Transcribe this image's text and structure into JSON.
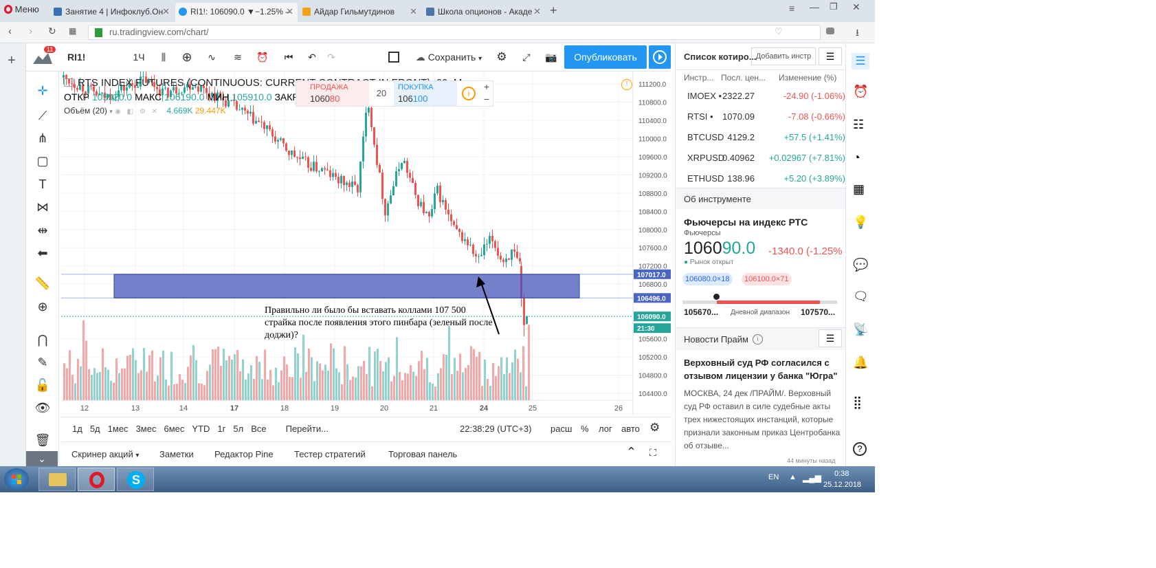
{
  "browser": {
    "menu_label": "Меню",
    "tabs": [
      {
        "title": "Занятие 4 | Инфоклуб.Он",
        "active": false
      },
      {
        "title": "RI1!: 106090.0 ▼−1.25% –",
        "active": true
      },
      {
        "title": "Айдар Гильмутдинов",
        "active": false
      },
      {
        "title": "Школа опционов - Акаде",
        "active": false
      }
    ],
    "url": "ru.tradingview.com/chart/"
  },
  "toolbar": {
    "symbol": "RI1!",
    "interval": "1Ч",
    "save_label": "Сохранить",
    "publish_label": "Опубликовать",
    "notification_count": "11"
  },
  "legend": {
    "title": "RTS INDEX FUTURES (CONTINUOUS: CURRENT CONTRACT IN FRONT), 60, MOEX",
    "open_label": "ОТКР",
    "open": "105920.0",
    "high_label": "МАКС",
    "high": "106190.0",
    "low_label": "МИН",
    "low": "105910.0",
    "close_label": "ЗАКР",
    "close": "1",
    "volume_label": "Объём (20)",
    "volume_value": "4.669K",
    "volume_ma": "29.447K"
  },
  "trade_widget": {
    "sell_label": "ПРОДАЖА",
    "sell_price_main": "1060",
    "sell_price_tail": "80",
    "spread": "20",
    "buy_label": "ПОКУПКА",
    "buy_price_main": "106",
    "buy_price_tail": "100"
  },
  "chart_data": {
    "type": "candlestick",
    "price_axis_ticks": [
      "111200.0",
      "110800.0",
      "110400.0",
      "110000.0",
      "109600.0",
      "109200.0",
      "108800.0",
      "108400.0",
      "108000.0",
      "107600.0",
      "107200.0",
      "106800.0",
      "105600.0",
      "105200.0",
      "104800.0",
      "104400.0"
    ],
    "time_axis_ticks": [
      "12",
      "13",
      "14",
      "17",
      "18",
      "19",
      "20",
      "21",
      "24",
      "25",
      "26"
    ],
    "price_labels": [
      {
        "value": "107017.0",
        "color": "#4a66c2"
      },
      {
        "value": "106496.0",
        "color": "#4a66c2"
      },
      {
        "value": "106090.0",
        "color": "#26a69a"
      },
      {
        "value": "21:30",
        "color": "#26a69a"
      }
    ],
    "zone": {
      "from": 106496,
      "to": 107017,
      "color": "#3f51b5"
    },
    "annotation": "Правильно ли было бы вставать коллами 107 500 страйка после появления этого пинбара (зеленый после доджи)?",
    "colors": {
      "up": "#26a69a",
      "down": "#ef5350"
    }
  },
  "range_bar": {
    "items": [
      "1д",
      "5д",
      "1мес",
      "3мес",
      "6мес",
      "YTD",
      "1г",
      "5л",
      "Все"
    ],
    "goto_label": "Перейти...",
    "clock": "22:38:29 (UTC+3)",
    "adj_label": "расш",
    "percent_label": "%",
    "log_label": "лог",
    "auto_label": "авто"
  },
  "panels": {
    "items": [
      "Скринер акций",
      "Заметки",
      "Редактор Pine",
      "Тестер стратегий",
      "Торговая панель"
    ]
  },
  "watchlist": {
    "title": "Список котиро...",
    "add_label": "Добавить инстр",
    "col_symbol": "Инстр...",
    "col_last": "Посл. цен...",
    "col_change": "Изменение (%)",
    "rows": [
      {
        "symbol": "IMOEX",
        "last": "2322.27",
        "change": "-24.90 (-1.06%)",
        "dir": "neg",
        "dot": "•"
      },
      {
        "symbol": "RTSI",
        "last": "1070.09",
        "change": "-7.08 (-0.66%)",
        "dir": "neg",
        "dot": "•"
      },
      {
        "symbol": "BTCUSD",
        "last": "4129.2",
        "change": "+57.5 (+1.41%)",
        "dir": "pos",
        "dot": ""
      },
      {
        "symbol": "XRPUSD",
        "last": "0.40962",
        "change": "+0.02967 (+7.81%)",
        "dir": "pos",
        "dot": ""
      },
      {
        "symbol": "ETHUSD",
        "last": "138.96",
        "change": "+5.20 (+3.89%)",
        "dir": "pos",
        "dot": ""
      }
    ]
  },
  "instrument": {
    "section_title": "Об инструменте",
    "name": "Фьючерсы на индекс РТС",
    "type": "Фьючерсы",
    "price_main": "1060",
    "price_tail": "90.0",
    "change": "-1340.0 (-1.25%",
    "market_status": "Рынок открыт",
    "bid": "106080.0×18",
    "ask": "106100.0×71",
    "range_low": "105670...",
    "range_label": "Дневной диапазон",
    "range_high": "107570..."
  },
  "news": {
    "title": "Новости Прайм",
    "headline": "Верховный суд РФ согласился с отзывом лицензии у банка \"Югра\"",
    "body": "МОСКВА, 24 дек /ПРАЙМ/. Верховный суд РФ оставил в силе судебные акты трех нижестоящих инстанций, которые признали законным приказ Центробанка об отзыве...",
    "time": "44 минуты назад"
  },
  "taskbar": {
    "lang": "EN",
    "time": "0:38",
    "date": "25.12.2018"
  }
}
